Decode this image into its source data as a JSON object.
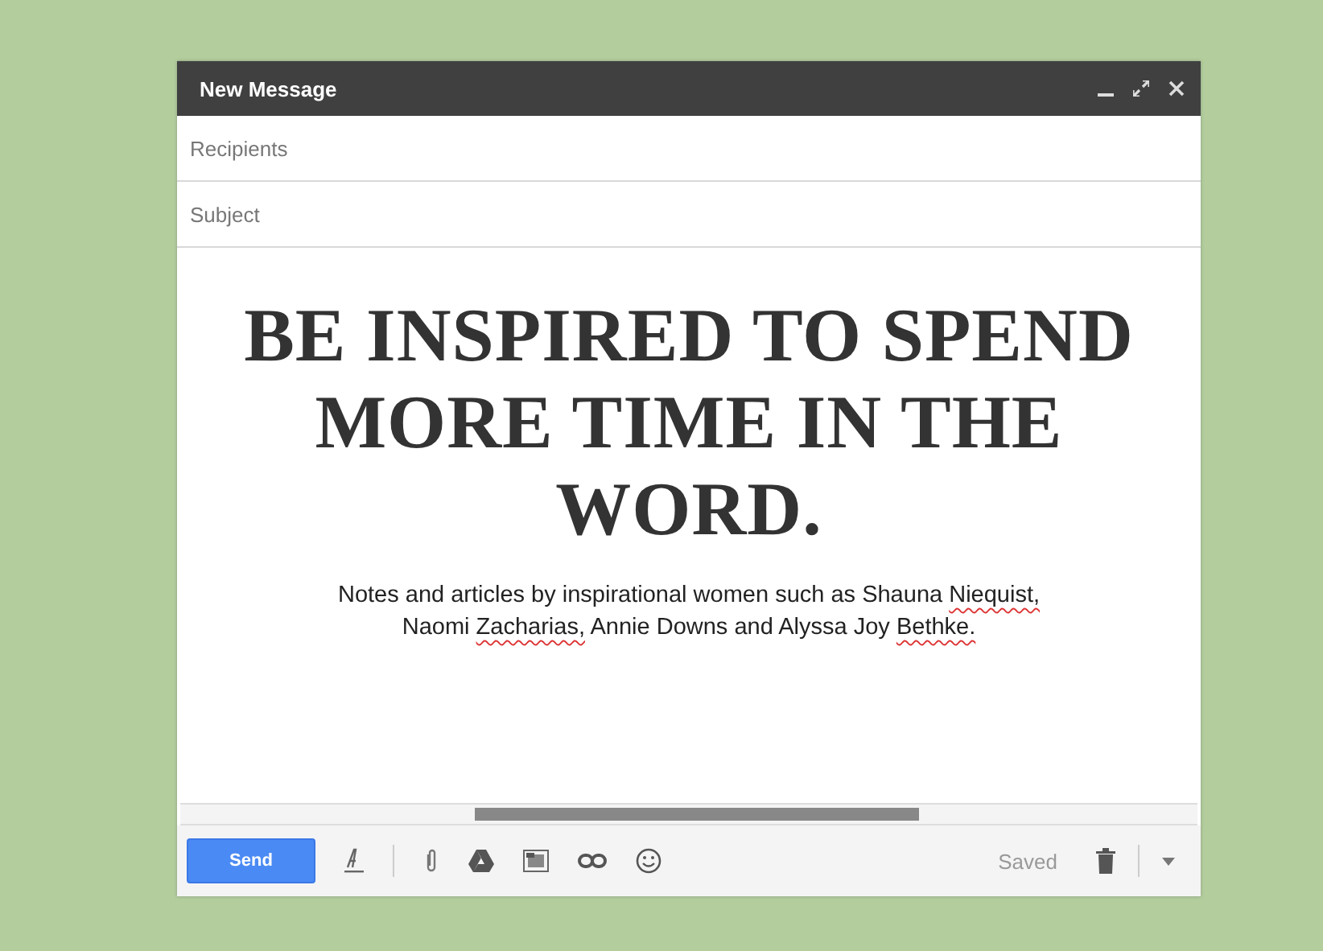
{
  "window": {
    "title": "New Message"
  },
  "fields": [
    {
      "placeholder": "Recipients"
    },
    {
      "placeholder": "Subject"
    }
  ],
  "body": {
    "headline": [
      "BE INSPIRED TO SPEND",
      "MORE TIME IN THE",
      "WORD."
    ],
    "paragraph": [
      {
        "text": "Notes and articles by inspirational women such as Shauna ",
        "misspelled": false
      },
      {
        "text": "Niequist,",
        "misspelled": true
      },
      {
        "text": " Naomi ",
        "misspelled": false
      },
      {
        "text": "Zacharias,",
        "misspelled": true
      },
      {
        "text": " Annie Downs and Alyssa Joy ",
        "misspelled": false
      },
      {
        "text": "Bethke.",
        "misspelled": true
      }
    ]
  },
  "toolbar": {
    "send": "Send",
    "status": "Saved"
  }
}
